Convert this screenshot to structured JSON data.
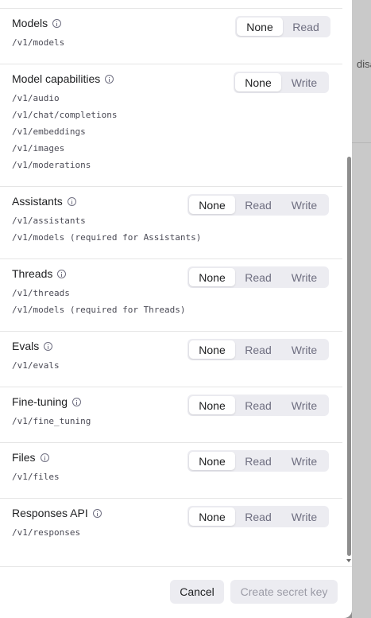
{
  "backdrop": {
    "partial_text": "disa"
  },
  "options": {
    "none": "None",
    "read": "Read",
    "write": "Write"
  },
  "permissions": [
    {
      "title": "Models",
      "endpoints": [
        "/v1/models"
      ],
      "selected": "None"
    },
    {
      "title": "Model capabilities",
      "endpoints": [
        "/v1/audio",
        "/v1/chat/completions",
        "/v1/embeddings",
        "/v1/images",
        "/v1/moderations"
      ],
      "selected": "None"
    },
    {
      "title": "Assistants",
      "endpoints": [
        "/v1/assistants",
        "/v1/models (required for Assistants)"
      ],
      "selected": "None"
    },
    {
      "title": "Threads",
      "endpoints": [
        "/v1/threads",
        "/v1/models (required for Threads)"
      ],
      "selected": "None"
    },
    {
      "title": "Evals",
      "endpoints": [
        "/v1/evals"
      ],
      "selected": "None"
    },
    {
      "title": "Fine-tuning",
      "endpoints": [
        "/v1/fine_tuning"
      ],
      "selected": "None"
    },
    {
      "title": "Files",
      "endpoints": [
        "/v1/files"
      ],
      "selected": "None"
    },
    {
      "title": "Responses API",
      "endpoints": [
        "/v1/responses"
      ],
      "selected": "None"
    }
  ],
  "footer": {
    "cancel_label": "Cancel",
    "create_label": "Create secret key"
  },
  "colors": {
    "accent_bg": "#ececf1",
    "text": "#202123",
    "muted": "#6e6e80",
    "divider": "#e5e5e5"
  }
}
